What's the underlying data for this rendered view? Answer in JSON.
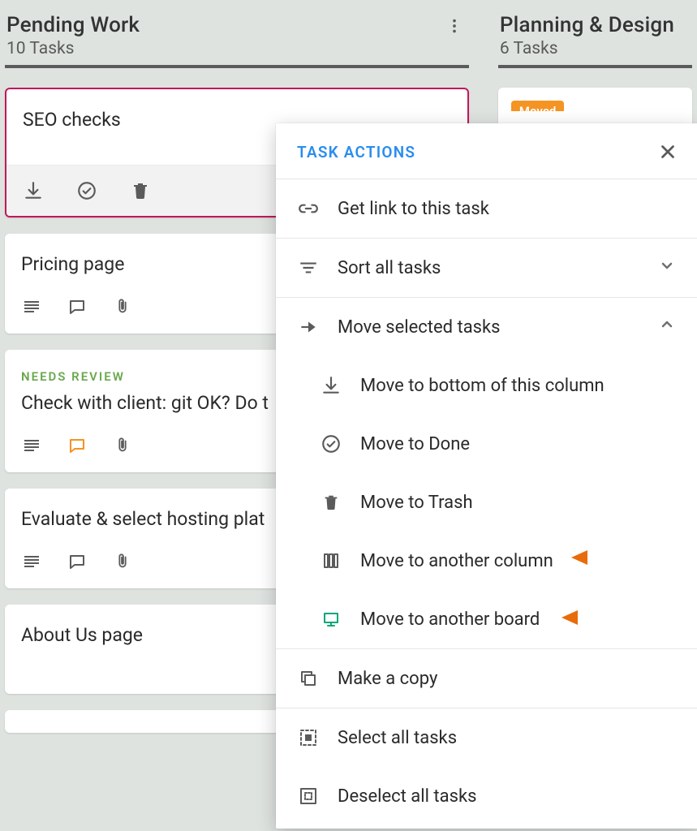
{
  "columns": {
    "pending": {
      "title": "Pending Work",
      "subtitle": "10 Tasks"
    },
    "planning": {
      "title": "Planning & Design",
      "subtitle": "6 Tasks",
      "badge": "Moved"
    }
  },
  "cards": {
    "seo": {
      "title": "SEO checks"
    },
    "pricing": {
      "title": "Pricing page"
    },
    "review": {
      "tag": "NEEDS REVIEW",
      "title": "Check with client: git OK? Do t"
    },
    "hosting": {
      "title": "Evaluate & select hosting plat"
    },
    "about": {
      "title": "About Us page"
    }
  },
  "menu": {
    "header": "TASK ACTIONS",
    "get_link": "Get link to this task",
    "sort_all": "Sort all tasks",
    "move_selected": "Move selected tasks",
    "move_bottom": "Move to bottom of this column",
    "move_done": "Move to Done",
    "move_trash": "Move to Trash",
    "move_column": "Move to another column",
    "move_board": "Move to another board",
    "make_copy": "Make a copy",
    "select_all": "Select all tasks",
    "deselect_all": "Deselect all tasks"
  }
}
